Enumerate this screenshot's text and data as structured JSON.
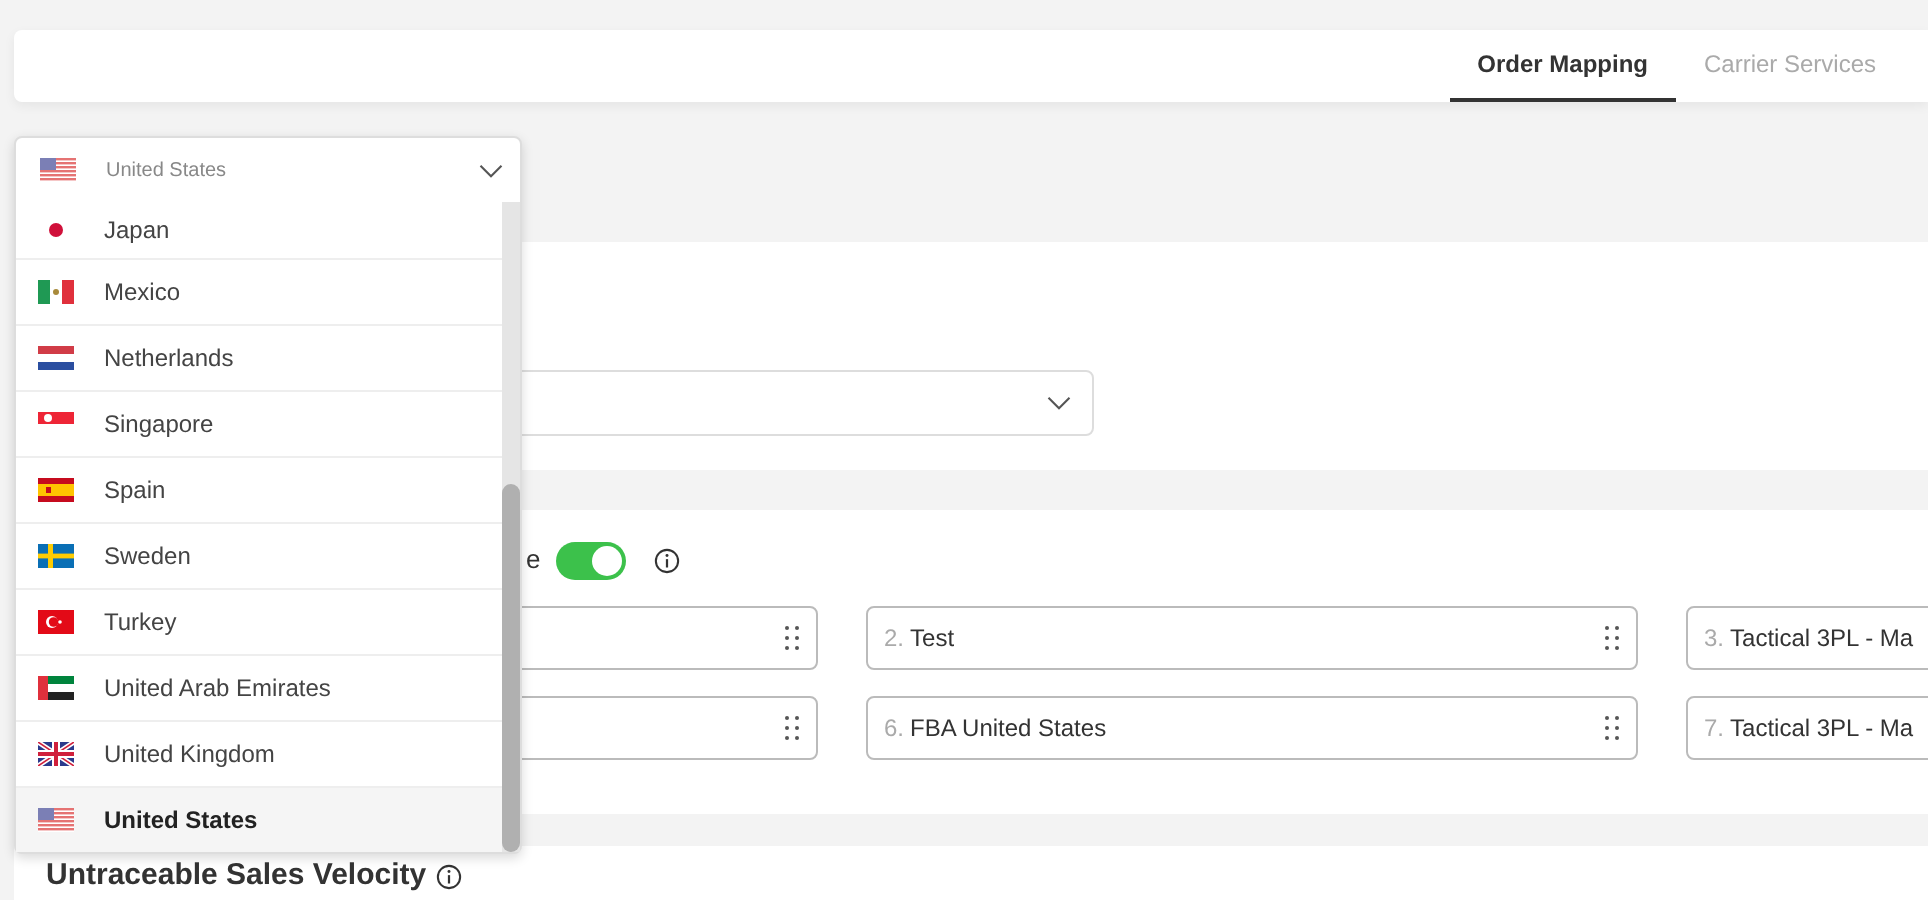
{
  "tabs": [
    {
      "label": "Order Mapping",
      "selected": true
    },
    {
      "label": "Carrier Services",
      "selected": false
    }
  ],
  "country_select": {
    "value": "United States",
    "expanded": true,
    "options": [
      {
        "label": "Japan",
        "selected": false
      },
      {
        "label": "Mexico",
        "selected": false
      },
      {
        "label": "Netherlands",
        "selected": false
      },
      {
        "label": "Singapore",
        "selected": false
      },
      {
        "label": "Spain",
        "selected": false
      },
      {
        "label": "Sweden",
        "selected": false
      },
      {
        "label": "Turkey",
        "selected": false
      },
      {
        "label": "United Arab Emirates",
        "selected": false
      },
      {
        "label": "United Kingdom",
        "selected": false
      },
      {
        "label": "United States",
        "selected": true
      }
    ]
  },
  "priority_section": {
    "label": "e",
    "toggle_on": true,
    "items": [
      {
        "kind": "blank"
      },
      {
        "kind": "labeled",
        "number": "2.",
        "name": "Test"
      },
      {
        "kind": "labeled",
        "number": "3.",
        "name": "Tactical 3PL - Ma"
      },
      {
        "kind": "blank"
      },
      {
        "kind": "labeled",
        "number": "6.",
        "name": "FBA United States"
      },
      {
        "kind": "labeled",
        "number": "7.",
        "name": "Tactical 3PL - Ma"
      }
    ]
  },
  "velocity_section": {
    "title": "Untraceable Sales Velocity"
  }
}
